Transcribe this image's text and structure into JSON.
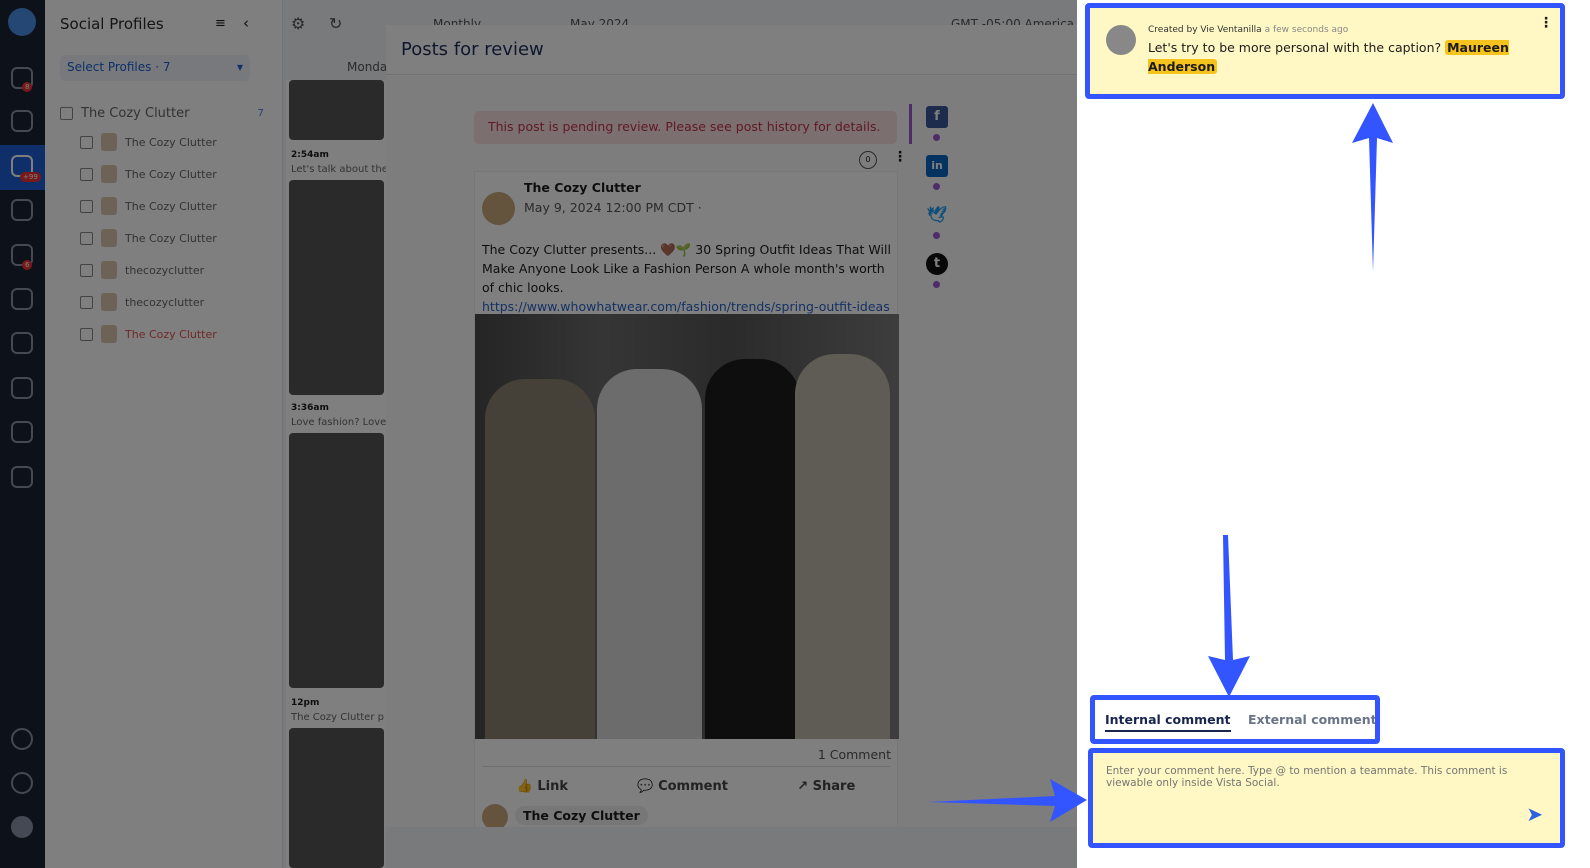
{
  "sidebar": {
    "title": "Social Profiles",
    "select_label": "Select Profiles · 7",
    "group": {
      "name": "The Cozy Clutter",
      "count": "7"
    },
    "profiles": [
      {
        "name": "The Cozy Clutter"
      },
      {
        "name": "The Cozy Clutter"
      },
      {
        "name": "The Cozy Clutter"
      },
      {
        "name": "The Cozy Clutter"
      },
      {
        "name": "thecozyclutter"
      },
      {
        "name": "thecozyclutter"
      },
      {
        "name": "The Cozy Clutter"
      }
    ],
    "badges": {
      "home": "8",
      "calendar": "+99",
      "inbox": "6"
    }
  },
  "calendar": {
    "view": "Monthly",
    "month": "May 2024",
    "timezone": "GMT -05:00 America",
    "day": "Monday",
    "posts": [
      {
        "time": "2:54am",
        "text": "Let's talk about the"
      },
      {
        "time": "3:36am",
        "text": "Love fashion? Love"
      },
      {
        "time": "12pm",
        "text": "The Cozy Clutter p"
      }
    ]
  },
  "modal": {
    "title": "Posts for review",
    "pending_notice": "This post is pending review. Please see post history for details.",
    "comment_badge": "0",
    "post": {
      "author": "The Cozy Clutter",
      "date": "May 9, 2024 12:00 PM CDT ·",
      "text": "The Cozy Clutter presents... 🤎🌱 30 Spring Outfit Ideas That Will Make Anyone Look Like a Fashion Person A whole month's worth of chic looks.",
      "link": "https://www.whowhatwear.com/fashion/trends/spring-outfit-ideas",
      "comment_count": "1 Comment",
      "actions": {
        "like": "Link",
        "comment": "Comment",
        "share": "Share"
      },
      "next_author": "The Cozy Clutter"
    },
    "networks": [
      {
        "name": "facebook",
        "glyph": "f",
        "color": "#3b5998"
      },
      {
        "name": "linkedin",
        "glyph": "in",
        "color": "#0a66c2"
      },
      {
        "name": "twitter",
        "glyph": "🐦",
        "color": "#1da1f2"
      },
      {
        "name": "tumblr",
        "glyph": "t",
        "color": "#111111"
      }
    ]
  },
  "comments": {
    "items": [
      {
        "created_by": "Created by Vie Ventanilla",
        "time": "a few seconds ago",
        "text": "Let's try to be more personal with the caption?",
        "mention": "Maureen Anderson"
      }
    ],
    "tabs": [
      {
        "label": "Internal comment",
        "active": true
      },
      {
        "label": "External comment",
        "active": false
      }
    ],
    "input_placeholder": "Enter your comment here. Type @ to mention a teammate. This comment is viewable only inside Vista Social."
  },
  "colors": {
    "highlight": "#3355ff",
    "comment_bg": "#fff8c4",
    "mention": "#f6c21c",
    "accent": "#1c5fd4"
  }
}
